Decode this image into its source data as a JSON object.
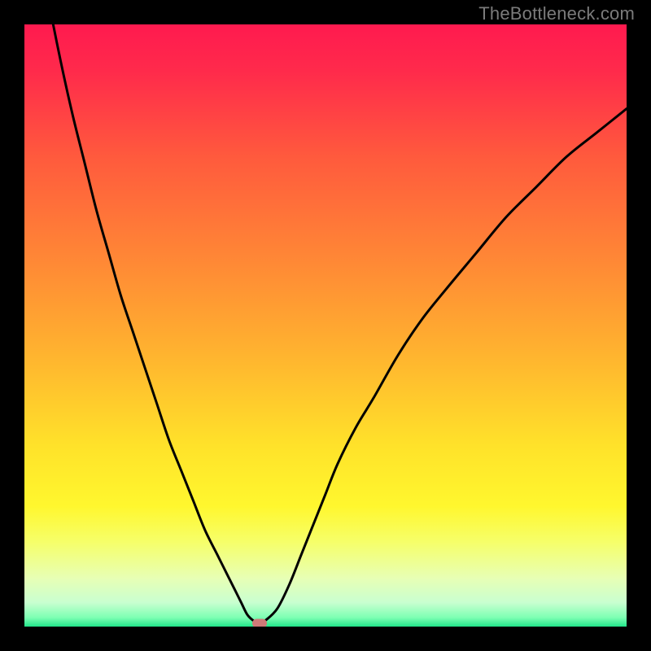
{
  "watermark": "TheBottleneck.com",
  "colors": {
    "gradient_stops": [
      {
        "offset": 0.0,
        "color": "#ff1a4f"
      },
      {
        "offset": 0.08,
        "color": "#ff2b4b"
      },
      {
        "offset": 0.22,
        "color": "#ff5a3d"
      },
      {
        "offset": 0.4,
        "color": "#ff8a35"
      },
      {
        "offset": 0.55,
        "color": "#ffb42f"
      },
      {
        "offset": 0.7,
        "color": "#ffe22a"
      },
      {
        "offset": 0.8,
        "color": "#fff72e"
      },
      {
        "offset": 0.86,
        "color": "#f6ff6a"
      },
      {
        "offset": 0.92,
        "color": "#e7ffb5"
      },
      {
        "offset": 0.96,
        "color": "#c9ffd0"
      },
      {
        "offset": 0.985,
        "color": "#7dffb3"
      },
      {
        "offset": 1.0,
        "color": "#22e58a"
      }
    ],
    "curve": "#000000",
    "marker": "#cf7a78",
    "frame": "#000000"
  },
  "chart_data": {
    "type": "line",
    "title": "",
    "xlabel": "",
    "ylabel": "",
    "xlim": [
      0,
      100
    ],
    "ylim": [
      0,
      100
    ],
    "grid": false,
    "x": [
      0,
      2,
      4,
      6,
      8,
      10,
      12,
      14,
      16,
      18,
      20,
      22,
      24,
      26,
      28,
      30,
      32,
      33,
      34,
      35,
      36,
      37,
      38,
      39,
      40,
      42,
      44,
      46,
      48,
      50,
      52,
      55,
      58,
      62,
      66,
      70,
      75,
      80,
      85,
      90,
      95,
      100
    ],
    "values": [
      130,
      115,
      104,
      94,
      85,
      77,
      69,
      62,
      55,
      49,
      43,
      37,
      31,
      26,
      21,
      16,
      12,
      10,
      8,
      6,
      4,
      2,
      1,
      0.5,
      1,
      3,
      7,
      12,
      17,
      22,
      27,
      33,
      38,
      45,
      51,
      56,
      62,
      68,
      73,
      78,
      82,
      86
    ],
    "marker": {
      "x": 39,
      "y": 0.5
    },
    "series_name": "bottleneck-curve"
  }
}
